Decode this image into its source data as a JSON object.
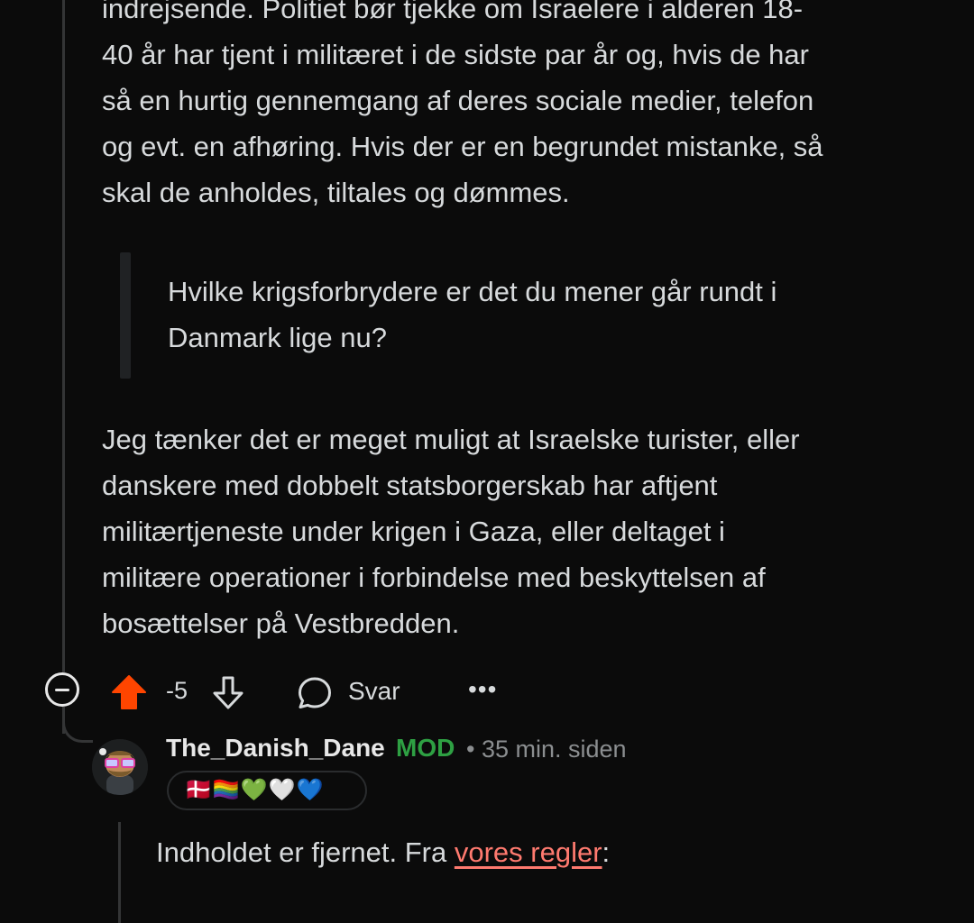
{
  "comment": {
    "paragraph1": [
      "indrejsende. Politiet bør tjekke om Israelere i alderen 18-",
      "40 år har tjent i militæret i de sidste par år og, hvis de har",
      "så en hurtig gennemgang af deres sociale medier, telefon",
      "og evt. en afhøring. Hvis der er en begrundet mistanke, så",
      "skal de anholdes, tiltales og dømmes."
    ],
    "quote": [
      "Hvilke krigsforbrydere er det du mener går rundt i",
      "Danmark lige nu?"
    ],
    "paragraph2": [
      "Jeg tænker det er meget muligt at Israelske turister, eller",
      "danskere med dobbelt statsborgerskab har aftjent",
      "militærtjeneste under krigen i Gaza, eller deltaget i",
      "militære operationer i forbindelse med beskyttelsen af",
      "bosættelser på Vestbredden."
    ]
  },
  "actions": {
    "score": "-5",
    "reply_label": "Svar",
    "more_label": "•••",
    "upvote_color": "#ff4500"
  },
  "reply": {
    "username": "The_Danish_Dane",
    "mod_label": "MOD",
    "separator": "•",
    "timestamp": "35 min. siden",
    "flair": "🇩🇰🏳️‍🌈💚🤍💙",
    "text_before": "Indholdet er fjernet. Fra ",
    "link_text": "vores regler",
    "text_after": ":"
  }
}
